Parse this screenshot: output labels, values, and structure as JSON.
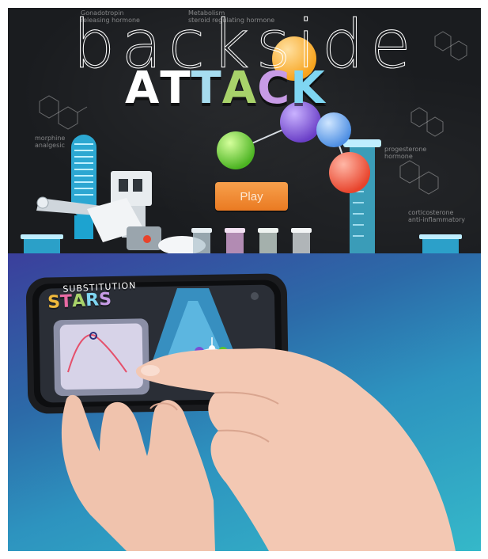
{
  "game": {
    "title_line1": "backside",
    "title_line2_letters": [
      {
        "ch": "A",
        "color": "#ffffff"
      },
      {
        "ch": "T",
        "color": "#ffffff"
      },
      {
        "ch": "T",
        "color": "#a6dcef"
      },
      {
        "ch": "A",
        "color": "#a8d26a"
      },
      {
        "ch": "C",
        "color": "#c79be6"
      },
      {
        "ch": "K",
        "color": "#7fd6f2"
      }
    ],
    "play_label": "Play",
    "chalk_notes": {
      "n1": "Gonadotropin",
      "n2": "releasing hormone",
      "n3": "Metabolism",
      "n4": "steroid regulating hormone",
      "n5": "morphine",
      "n6": "analgesic",
      "n7": "progesterone",
      "n8": "hormone",
      "n9": "corticosterone",
      "n10": "anti-inflammatory"
    },
    "ball_colors": {
      "orange": "#f7a21b",
      "purple": "#7b4fd4",
      "blue": "#5fa0ea",
      "red": "#e8432b",
      "green": "#5cc52b"
    }
  },
  "photo": {
    "app_logo_line1": "SUBSTITUTION",
    "app_logo_letters": [
      {
        "ch": "S",
        "color": "#f0b93c"
      },
      {
        "ch": "T",
        "color": "#e86aa3"
      },
      {
        "ch": "A",
        "color": "#a8d26a"
      },
      {
        "ch": "R",
        "color": "#7fd6f2"
      },
      {
        "ch": "S",
        "color": "#c79be6"
      }
    ],
    "bg_colors": [
      "#3b3f9c",
      "#2d93bf",
      "#35b8c9"
    ]
  }
}
